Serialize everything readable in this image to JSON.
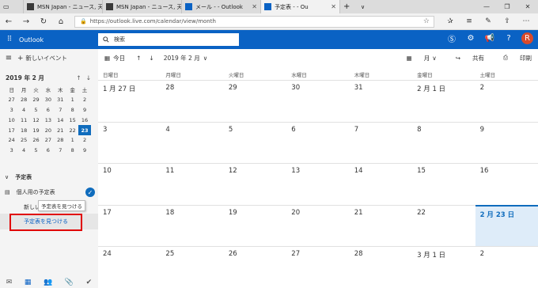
{
  "tabs": [
    {
      "label": "MSN Japan - ニュース, 天気, メ",
      "favicon_color": "#3a3a3a"
    },
    {
      "label": "MSN Japan - ニュース, 天気, メ",
      "favicon_color": "#3a3a3a"
    },
    {
      "label": "メール -           - Outlook",
      "favicon_color": "#0a62c4"
    },
    {
      "label": "予定表 -           - Ou",
      "favicon_color": "#0a62c4"
    }
  ],
  "browser": {
    "url": "https://outlook.live.com/calendar/view/month"
  },
  "outlook": {
    "app_name": "Outlook",
    "search_placeholder": "検索",
    "avatar_letter": "R",
    "brand_color": "#0a62c4"
  },
  "sidebar": {
    "new_event": "新しいイベント",
    "mini_month": "2019 年 2 月",
    "weekdays": [
      "日",
      "月",
      "火",
      "水",
      "木",
      "金",
      "土"
    ],
    "weeks": [
      [
        "27",
        "28",
        "29",
        "30",
        "31",
        "1",
        "2"
      ],
      [
        "3",
        "4",
        "5",
        "6",
        "7",
        "8",
        "9"
      ],
      [
        "10",
        "11",
        "12",
        "13",
        "14",
        "15",
        "16"
      ],
      [
        "17",
        "18",
        "19",
        "20",
        "21",
        "22",
        "23"
      ],
      [
        "24",
        "25",
        "26",
        "27",
        "28",
        "1",
        "2"
      ],
      [
        "3",
        "4",
        "5",
        "6",
        "7",
        "8",
        "9"
      ]
    ],
    "selected_day": "23",
    "section_title": "予定表",
    "my_calendar": "個人用の予定表",
    "new_calendar": "新しい",
    "tooltip": "予定表を見つける",
    "find_calendar": "予定表を見つける"
  },
  "command": {
    "today": "今日",
    "month_label": "2019 年 2 月",
    "view": "月",
    "share": "共有",
    "print": "印刷"
  },
  "calendar": {
    "weekdays": [
      "日曜日",
      "月曜日",
      "火曜日",
      "水曜日",
      "木曜日",
      "金曜日",
      "土曜日"
    ],
    "weeks": [
      [
        "1 月 27 日",
        "28",
        "29",
        "30",
        "31",
        "2 月 1 日",
        "2"
      ],
      [
        "3",
        "4",
        "5",
        "6",
        "7",
        "8",
        "9"
      ],
      [
        "10",
        "11",
        "12",
        "13",
        "14",
        "15",
        "16"
      ],
      [
        "17",
        "18",
        "19",
        "20",
        "21",
        "22",
        "2 月 23 日"
      ],
      [
        "24",
        "25",
        "26",
        "27",
        "28",
        "3 月 1 日",
        "2"
      ]
    ],
    "today_label": "2 月 23 日"
  }
}
